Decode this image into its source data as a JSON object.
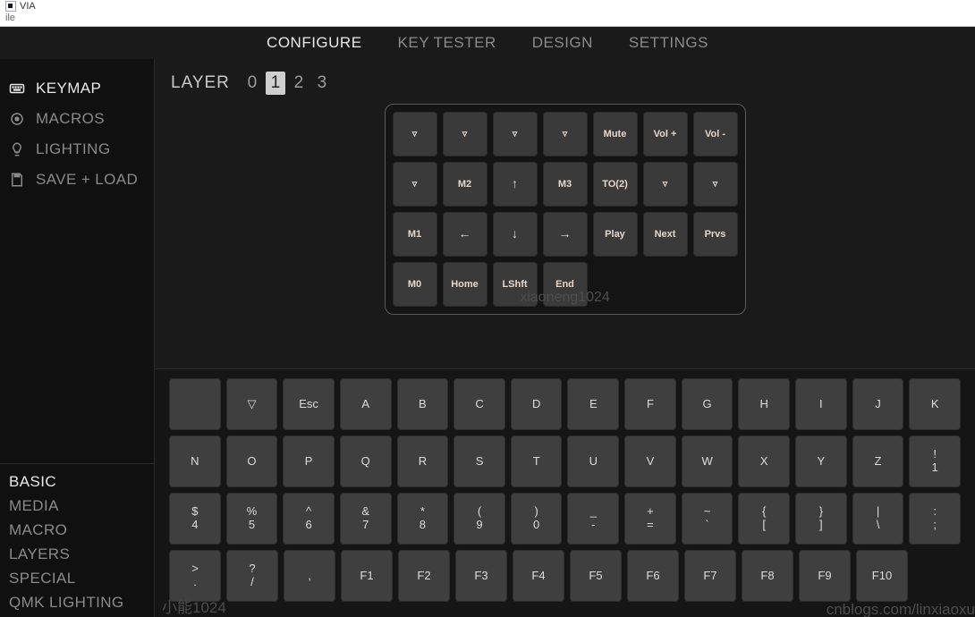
{
  "window": {
    "title": "VIA",
    "menu_file": "ile"
  },
  "topnav": {
    "tabs": [
      "CONFIGURE",
      "KEY TESTER",
      "DESIGN",
      "SETTINGS"
    ],
    "active_index": 0
  },
  "sidebar_top": {
    "items": [
      {
        "icon": "keyboard-icon",
        "label": "KEYMAP"
      },
      {
        "icon": "record-icon",
        "label": "MACROS"
      },
      {
        "icon": "bulb-icon",
        "label": "LIGHTING"
      },
      {
        "icon": "save-icon",
        "label": "SAVE + LOAD"
      }
    ],
    "active_index": 0
  },
  "layers": {
    "label": "LAYER",
    "values": [
      "0",
      "1",
      "2",
      "3"
    ],
    "active_index": 1
  },
  "keymap_rows": [
    [
      "▿",
      "▿",
      "▿",
      "▿",
      "Mute",
      "Vol +",
      "Vol -"
    ],
    [
      "▿",
      "M2",
      "↑",
      "M3",
      "TO(2)",
      "▿",
      "▿"
    ],
    [
      "M1",
      "←",
      "↓",
      "→",
      "Play",
      "Next",
      "Prvs"
    ],
    [
      "M0",
      "Home",
      "LShft",
      "End"
    ]
  ],
  "picker_categories": {
    "items": [
      "BASIC",
      "MEDIA",
      "MACRO",
      "LAYERS",
      "SPECIAL",
      "QMK LIGHTING"
    ],
    "active_index": 0
  },
  "picker_rows": [
    [
      {
        "top": "",
        "bottom": ""
      },
      {
        "top": "▽",
        "bottom": ""
      },
      {
        "top": "Esc",
        "bottom": ""
      },
      {
        "top": "A",
        "bottom": ""
      },
      {
        "top": "B",
        "bottom": ""
      },
      {
        "top": "C",
        "bottom": ""
      },
      {
        "top": "D",
        "bottom": ""
      },
      {
        "top": "E",
        "bottom": ""
      },
      {
        "top": "F",
        "bottom": ""
      },
      {
        "top": "G",
        "bottom": ""
      },
      {
        "top": "H",
        "bottom": ""
      },
      {
        "top": "I",
        "bottom": ""
      },
      {
        "top": "J",
        "bottom": ""
      },
      {
        "top": "K",
        "bottom": ""
      }
    ],
    [
      {
        "top": "N",
        "bottom": ""
      },
      {
        "top": "O",
        "bottom": ""
      },
      {
        "top": "P",
        "bottom": ""
      },
      {
        "top": "Q",
        "bottom": ""
      },
      {
        "top": "R",
        "bottom": ""
      },
      {
        "top": "S",
        "bottom": ""
      },
      {
        "top": "T",
        "bottom": ""
      },
      {
        "top": "U",
        "bottom": ""
      },
      {
        "top": "V",
        "bottom": ""
      },
      {
        "top": "W",
        "bottom": ""
      },
      {
        "top": "X",
        "bottom": ""
      },
      {
        "top": "Y",
        "bottom": ""
      },
      {
        "top": "Z",
        "bottom": ""
      },
      {
        "top": "!",
        "bottom": "1"
      }
    ],
    [
      {
        "top": "$",
        "bottom": "4"
      },
      {
        "top": "%",
        "bottom": "5"
      },
      {
        "top": "^",
        "bottom": "6"
      },
      {
        "top": "&",
        "bottom": "7"
      },
      {
        "top": "*",
        "bottom": "8"
      },
      {
        "top": "(",
        "bottom": "9"
      },
      {
        "top": ")",
        "bottom": "0"
      },
      {
        "top": "_",
        "bottom": "-"
      },
      {
        "top": "+",
        "bottom": "="
      },
      {
        "top": "~",
        "bottom": "`"
      },
      {
        "top": "{",
        "bottom": "["
      },
      {
        "top": "}",
        "bottom": "]"
      },
      {
        "top": "|",
        "bottom": "\\"
      },
      {
        "top": ":",
        "bottom": ";"
      }
    ],
    [
      {
        "top": ">",
        "bottom": "."
      },
      {
        "top": "?",
        "bottom": "/"
      },
      {
        "top": "",
        "bottom": ","
      },
      {
        "top": "F1",
        "bottom": ""
      },
      {
        "top": "F2",
        "bottom": ""
      },
      {
        "top": "F3",
        "bottom": ""
      },
      {
        "top": "F4",
        "bottom": ""
      },
      {
        "top": "F5",
        "bottom": ""
      },
      {
        "top": "F6",
        "bottom": ""
      },
      {
        "top": "F7",
        "bottom": ""
      },
      {
        "top": "F8",
        "bottom": ""
      },
      {
        "top": "F9",
        "bottom": ""
      },
      {
        "top": "F10",
        "bottom": ""
      }
    ]
  ],
  "watermarks": {
    "center": "xiaoneng1024",
    "bottom_left": "小能1024",
    "bottom_right": "cnblogs.com/linxiaoxu"
  }
}
